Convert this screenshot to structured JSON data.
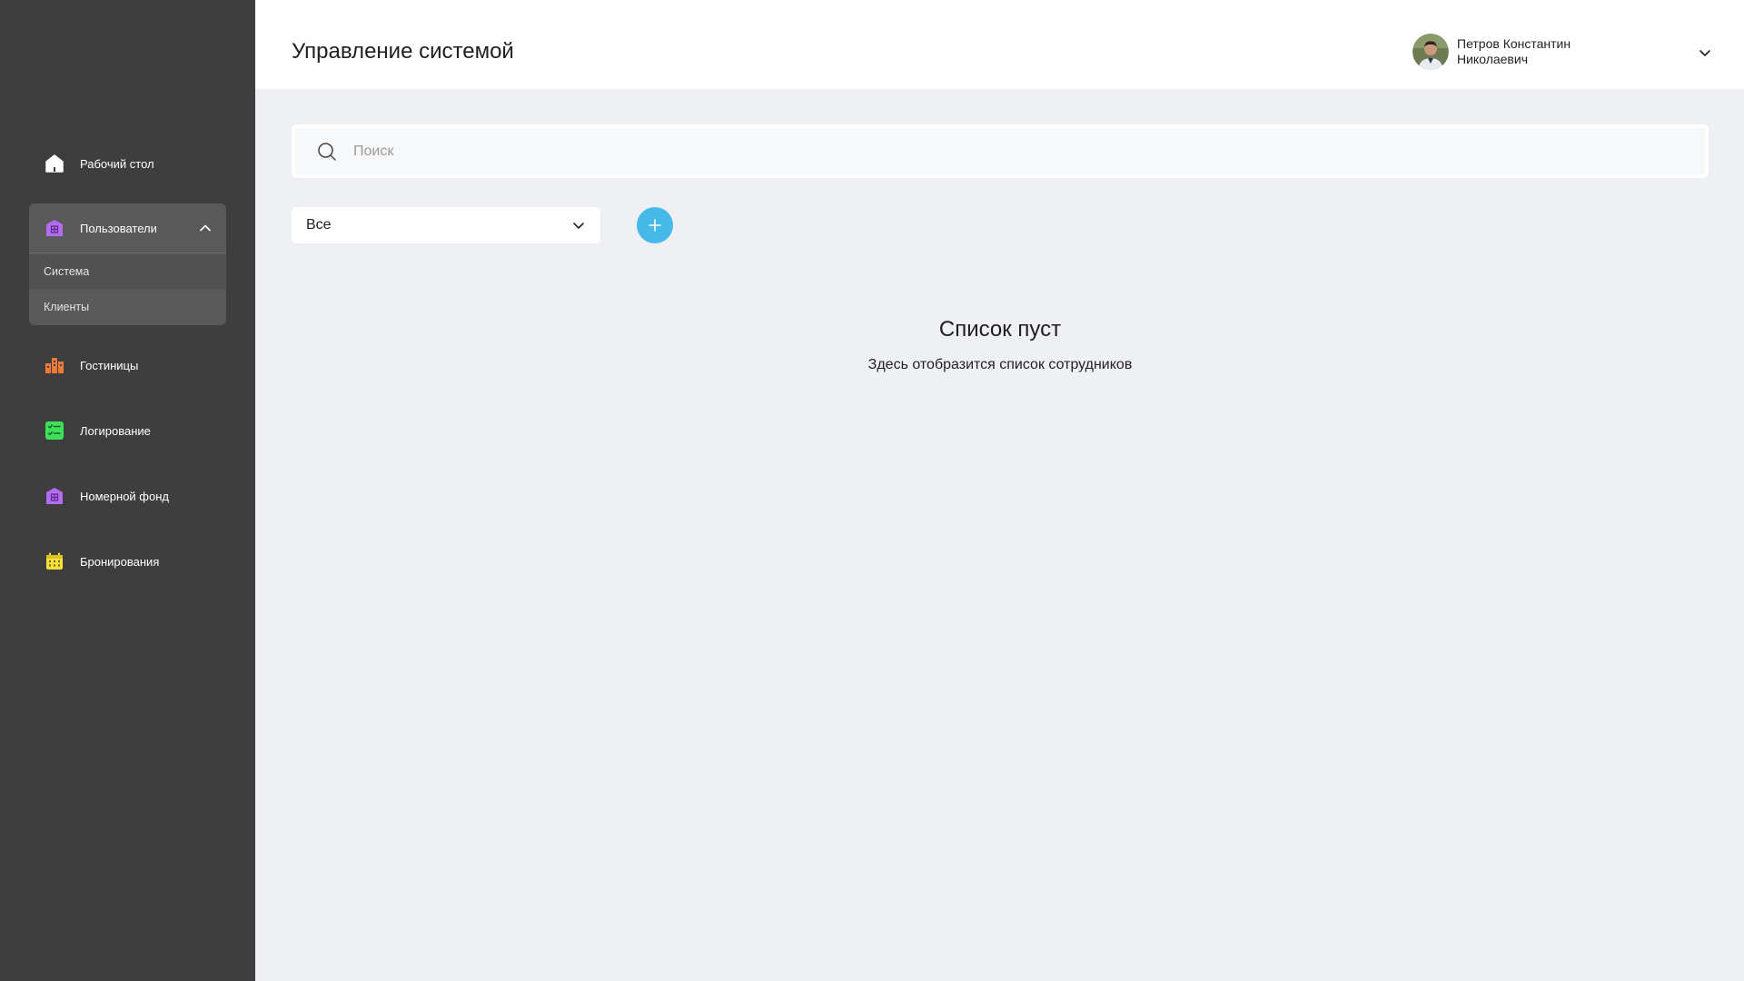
{
  "header": {
    "title": "Управление системой",
    "user_name": "Петров Константин Николаевич"
  },
  "sidebar": {
    "items": [
      {
        "label": "Рабочий стол",
        "icon": "home-icon",
        "color": "#ffffff"
      },
      {
        "label": "Пользователи",
        "icon": "users-icon",
        "color": "#b46cf0",
        "expanded": true,
        "children": [
          {
            "label": "Система",
            "active": true
          },
          {
            "label": "Клиенты",
            "active": false
          }
        ]
      },
      {
        "label": "Гостиницы",
        "icon": "hotels-icon",
        "color": "#f07a3a"
      },
      {
        "label": "Логирование",
        "icon": "logging-icon",
        "color": "#3ee05a"
      },
      {
        "label": "Номерной фонд",
        "icon": "rooms-icon",
        "color": "#b46cf0"
      },
      {
        "label": "Бронирования",
        "icon": "calendar-icon",
        "color": "#f5e13a"
      }
    ]
  },
  "search": {
    "placeholder": "Поиск",
    "value": ""
  },
  "filter": {
    "selected": "Все"
  },
  "add_button": {
    "icon": "plus-icon",
    "color": "#47b9e8"
  },
  "empty_state": {
    "title": "Список пуст",
    "subtitle": "Здесь отобразится список сотрудников"
  }
}
